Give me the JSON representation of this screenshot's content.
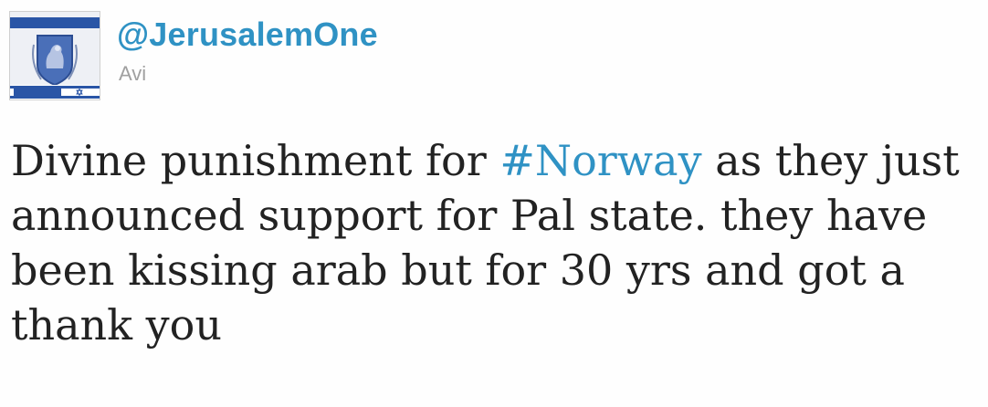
{
  "tweet": {
    "handle": "@JerusalemOne",
    "display_name": "Avi",
    "text_before": "Divine punishment for ",
    "hashtag": "#Norway",
    "text_after": " as they just announced support for Pal state. they have been kissing arab but for 30 yrs and got a thank you",
    "colors": {
      "link": "#2f92c4",
      "text": "#222222",
      "muted": "#a0a0a0"
    }
  },
  "avatar": {
    "icon": "jerusalem-emblem-icon",
    "flag_icon": "israel-flag-icon"
  }
}
